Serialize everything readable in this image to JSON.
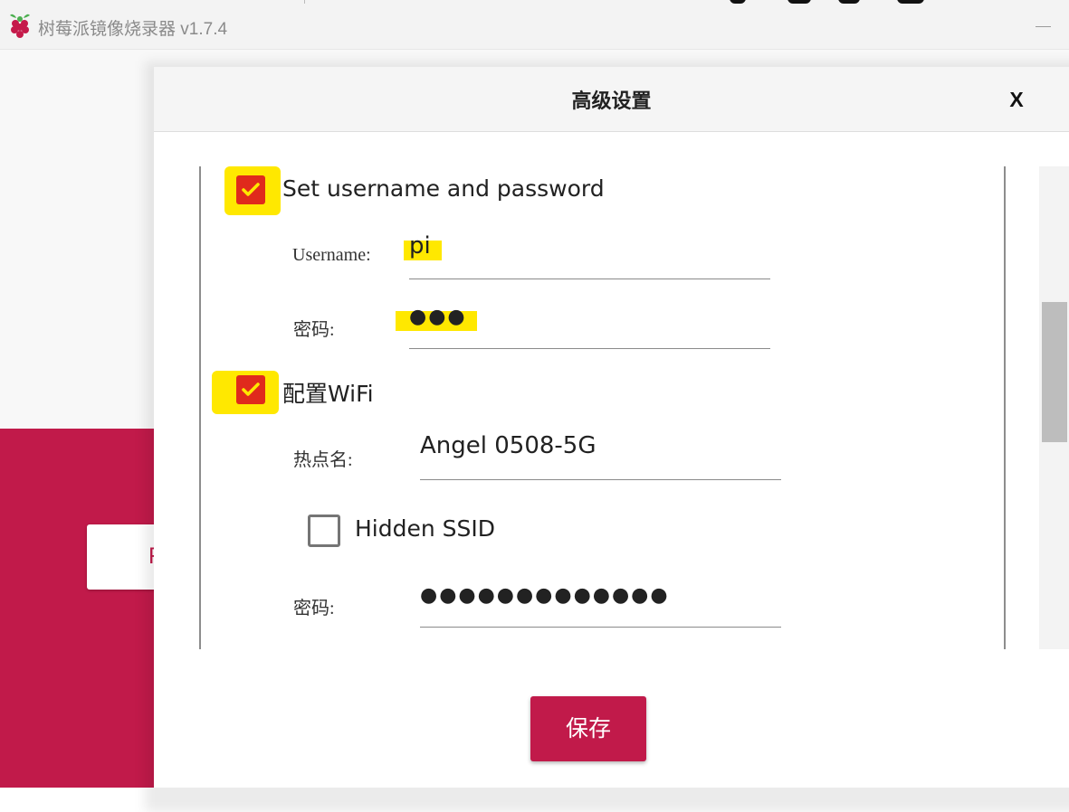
{
  "window": {
    "title": "树莓派镜像烧录器 v1.7.4",
    "background_button_letter": "R"
  },
  "dialog": {
    "title": "高级设置",
    "close_label": "X",
    "user_section": {
      "checkbox_label": "Set username and password",
      "checked": true,
      "username_label": "Username:",
      "username_value": "pi",
      "password_label": "密码:",
      "password_value": "●●●"
    },
    "wifi_section": {
      "checkbox_label": "配置WiFi",
      "checked": true,
      "ssid_label": "热点名:",
      "ssid_value": "Angel 0508-5G",
      "hidden_ssid_label": "Hidden SSID",
      "hidden_ssid_checked": false,
      "password_label": "密码:",
      "password_value": "●●●●●●●●●●●●●"
    },
    "save_label": "保存"
  },
  "colors": {
    "accent": "#c11a4a",
    "checkbox_checked": "#e02a1c",
    "highlight": "#ffe800"
  },
  "icons": {
    "app_logo": "raspberry-icon",
    "checkmark": "checkmark-icon"
  }
}
